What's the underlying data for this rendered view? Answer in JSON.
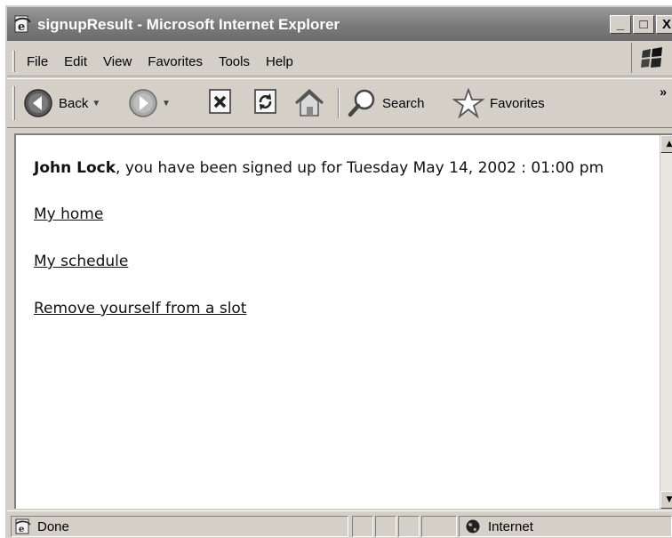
{
  "window": {
    "title": "signupResult - Microsoft Internet Explorer",
    "controls": {
      "minimize": "_",
      "maximize": "□",
      "close": "X"
    }
  },
  "menu": {
    "items": [
      {
        "label": "File",
        "accel": "F"
      },
      {
        "label": "Edit",
        "accel": "E"
      },
      {
        "label": "View",
        "accel": "V"
      },
      {
        "label": "Favorites",
        "accel": "a"
      },
      {
        "label": "Tools",
        "accel": "T"
      },
      {
        "label": "Help",
        "accel": "H"
      }
    ]
  },
  "toolbar": {
    "back_label": "Back",
    "search_label": "Search",
    "favorites_label": "Favorites",
    "more": "»"
  },
  "page": {
    "user_name": "John Lock",
    "message": ", you have been signed up for Tuesday May 14, 2002 : 01:00 pm",
    "links": [
      "My home",
      "My schedule",
      "Remove yourself from a slot"
    ]
  },
  "statusbar": {
    "status_text": "Done",
    "zone_text": "Internet"
  },
  "icons": {
    "ie_title": "ie-page-icon",
    "back": "back-arrow-icon",
    "forward": "forward-arrow-icon",
    "stop": "stop-icon",
    "refresh": "refresh-icon",
    "home": "home-icon",
    "search": "search-magnifier-icon",
    "favorites": "favorites-star-icon",
    "zone": "internet-globe-icon"
  }
}
